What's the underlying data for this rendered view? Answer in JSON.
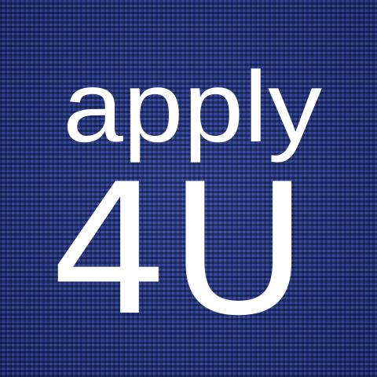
{
  "logo": {
    "line1": "apply",
    "line2": "4U",
    "text_color": "#ffffff",
    "background_color": "#2a3f93",
    "background_pattern": "blue-plaid-weave"
  }
}
